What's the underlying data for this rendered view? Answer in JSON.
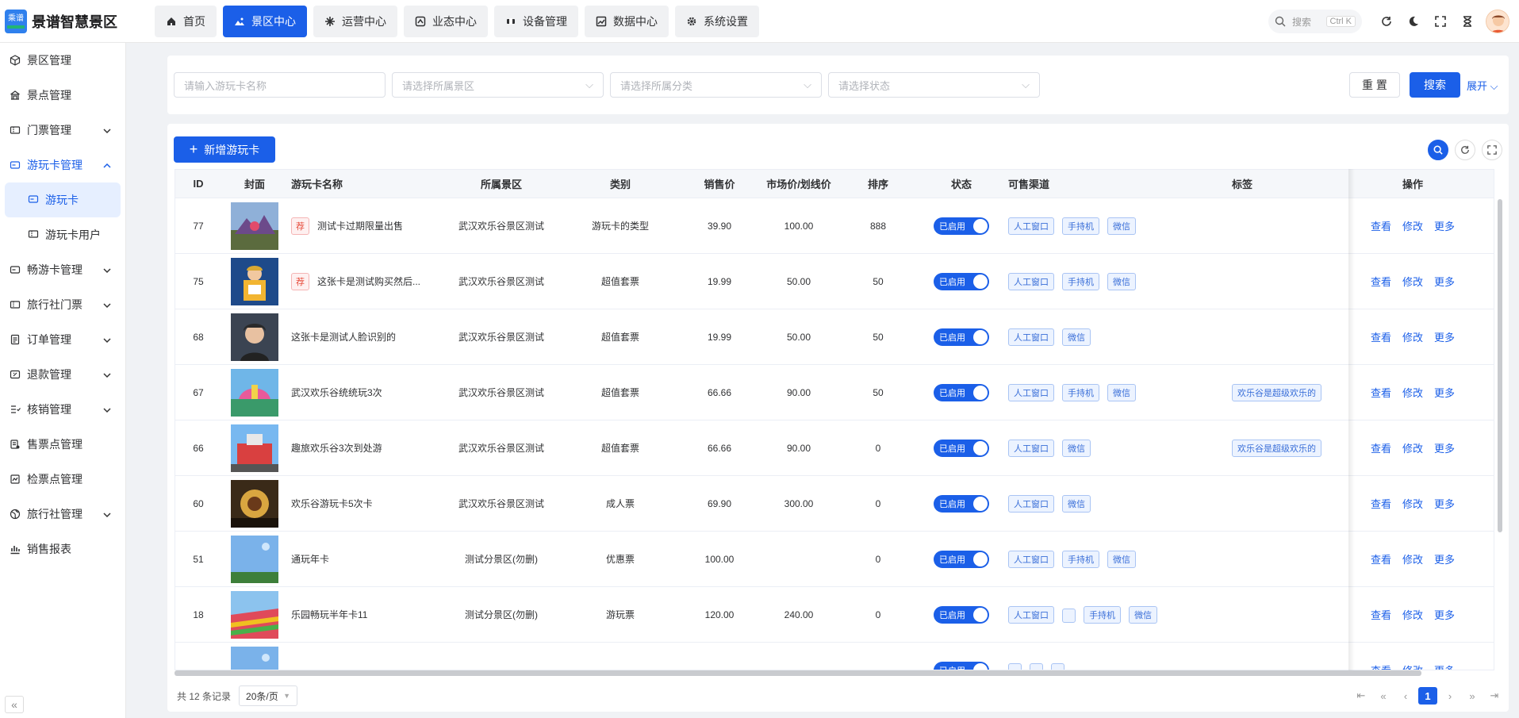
{
  "app": {
    "logo_text": "景谱智慧景区",
    "logo_badge": "乘谱"
  },
  "nav_tabs": [
    {
      "label": "首页",
      "icon": "home-icon"
    },
    {
      "label": "景区中心",
      "icon": "landscape-icon",
      "active": true
    },
    {
      "label": "运营中心",
      "icon": "operation-icon"
    },
    {
      "label": "业态中心",
      "icon": "business-icon"
    },
    {
      "label": "设备管理",
      "icon": "device-icon"
    },
    {
      "label": "数据中心",
      "icon": "chart-icon"
    },
    {
      "label": "系统设置",
      "icon": "gear-icon"
    }
  ],
  "header": {
    "search_placeholder": "搜索",
    "search_shortcut": "Ctrl K"
  },
  "sidebar": {
    "items": [
      {
        "label": "景区管理",
        "icon": "cube-icon"
      },
      {
        "label": "景点管理",
        "icon": "building-icon"
      },
      {
        "label": "门票管理",
        "icon": "ticket-icon",
        "expandable": true
      },
      {
        "label": "游玩卡管理",
        "icon": "card-icon",
        "expandable": true,
        "open": true
      },
      {
        "label": "畅游卡管理",
        "icon": "card-icon",
        "expandable": true
      },
      {
        "label": "旅行社门票",
        "icon": "ticket-icon",
        "expandable": true
      },
      {
        "label": "订单管理",
        "icon": "order-icon",
        "expandable": true
      },
      {
        "label": "退款管理",
        "icon": "refund-icon",
        "expandable": true
      },
      {
        "label": "核销管理",
        "icon": "verify-icon",
        "expandable": true
      },
      {
        "label": "售票点管理",
        "icon": "store-icon"
      },
      {
        "label": "检票点管理",
        "icon": "gate-icon"
      },
      {
        "label": "旅行社管理",
        "icon": "globe-icon",
        "expandable": true
      },
      {
        "label": "销售报表",
        "icon": "report-icon"
      }
    ],
    "subitems": [
      {
        "label": "游玩卡",
        "active": true
      },
      {
        "label": "游玩卡用户"
      }
    ]
  },
  "filter": {
    "name_placeholder": "请输入游玩卡名称",
    "area_placeholder": "请选择所属景区",
    "category_placeholder": "请选择所属分类",
    "status_placeholder": "请选择状态",
    "reset_label": "重 置",
    "search_label": "搜索",
    "expand_label": "展开"
  },
  "toolbar": {
    "add_label": "新增游玩卡"
  },
  "table": {
    "columns": [
      "ID",
      "封面",
      "游玩卡名称",
      "所属景区",
      "类别",
      "销售价",
      "市场价/划线价",
      "排序",
      "状态",
      "可售渠道",
      "标签",
      "操作"
    ],
    "status_label": "已启用",
    "actions": [
      "查看",
      "修改",
      "更多"
    ],
    "rows": [
      {
        "id": "77",
        "rec": true,
        "name": "测试卡过期限量出售",
        "area": "武汉欢乐谷景区测试",
        "type": "游玩卡的类型",
        "price": "39.90",
        "market": "100.00",
        "sort": "888",
        "channels": [
          "人工窗口",
          "手持机",
          "微信"
        ],
        "tag": "",
        "cover": "c1"
      },
      {
        "id": "75",
        "rec": true,
        "name": "这张卡是测试购买然后...",
        "area": "武汉欢乐谷景区测试",
        "type": "超值套票",
        "price": "19.99",
        "market": "50.00",
        "sort": "50",
        "channels": [
          "人工窗口",
          "手持机",
          "微信"
        ],
        "tag": "",
        "cover": "c2"
      },
      {
        "id": "68",
        "rec": false,
        "name": "这张卡是测试人脸识别的",
        "area": "武汉欢乐谷景区测试",
        "type": "超值套票",
        "price": "19.99",
        "market": "50.00",
        "sort": "50",
        "channels": [
          "人工窗口",
          "微信"
        ],
        "tag": "",
        "cover": "c3"
      },
      {
        "id": "67",
        "rec": false,
        "name": "武汉欢乐谷统统玩3次",
        "area": "武汉欢乐谷景区测试",
        "type": "超值套票",
        "price": "66.66",
        "market": "90.00",
        "sort": "50",
        "channels": [
          "人工窗口",
          "手持机",
          "微信"
        ],
        "tag": "欢乐谷是超级欢乐的",
        "cover": "c4"
      },
      {
        "id": "66",
        "rec": false,
        "name": "趣旅欢乐谷3次到处游",
        "area": "武汉欢乐谷景区测试",
        "type": "超值套票",
        "price": "66.66",
        "market": "90.00",
        "sort": "0",
        "channels": [
          "人工窗口",
          "微信"
        ],
        "tag": "欢乐谷是超级欢乐的",
        "cover": "c5"
      },
      {
        "id": "60",
        "rec": false,
        "name": "欢乐谷游玩卡5次卡",
        "area": "武汉欢乐谷景区测试",
        "type": "成人票",
        "price": "69.90",
        "market": "300.00",
        "sort": "0",
        "channels": [
          "人工窗口",
          "微信"
        ],
        "tag": "",
        "cover": "c6"
      },
      {
        "id": "51",
        "rec": false,
        "name": "通玩年卡",
        "area": "测试分景区(勿删)",
        "type": "优惠票",
        "price": "100.00",
        "market": "",
        "sort": "0",
        "channels": [
          "人工窗口",
          "手持机",
          "微信"
        ],
        "tag": "",
        "cover": "c7"
      },
      {
        "id": "18",
        "rec": false,
        "name": "乐园畅玩半年卡11",
        "area": "测试分景区(勿删)",
        "type": "游玩票",
        "price": "120.00",
        "market": "240.00",
        "sort": "0",
        "channels": [
          "人工窗口",
          "",
          "手持机",
          "微信"
        ],
        "tag": "",
        "cover": "c8"
      },
      {
        "id": "",
        "rec": false,
        "name": "",
        "area": "",
        "type": "",
        "price": "",
        "market": "",
        "sort": "",
        "channels": [
          "",
          "",
          ""
        ],
        "tag": "",
        "cover": "c7"
      }
    ]
  },
  "pagination": {
    "total_label": "共 12 条记录",
    "page_size": "20条/页",
    "current_page": "1"
  },
  "colors": {
    "primary": "#1b5fe8",
    "chip_bg": "#ecf3ff",
    "rec_red": "#e74c3c"
  }
}
